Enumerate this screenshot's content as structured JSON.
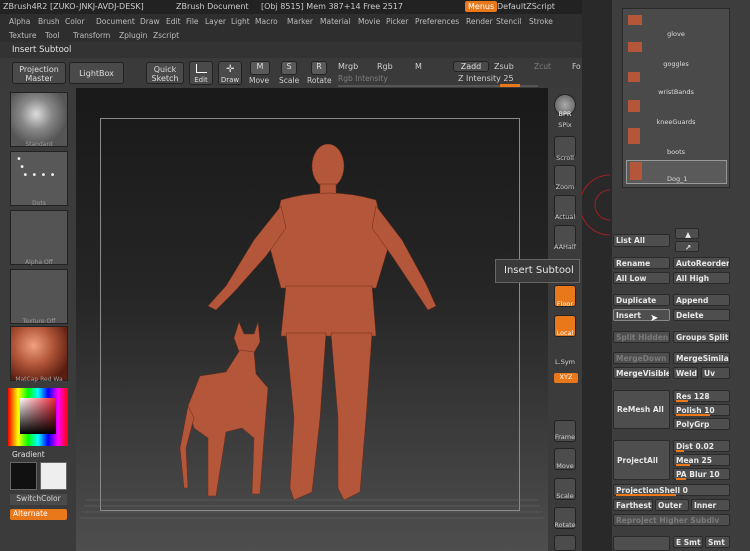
{
  "titlebar": {
    "app": "ZBrush4R2",
    "machine": "[ZUKO-JNKJ-AVDJ-DESK]",
    "document": "ZBrush Document",
    "stats": "[Obj 8515] Mem 387+14 Free 2517",
    "menus_btn": "Menus",
    "script": "DefaultZScript"
  },
  "menu": {
    "row1": [
      "Alpha",
      "Brush",
      "Color",
      "Document",
      "Draw",
      "Edit",
      "File",
      "Layer",
      "Light",
      "Macro",
      "Marker",
      "Material",
      "Movie",
      "Picker",
      "Preferences",
      "Render",
      "Stencil",
      "Stroke"
    ],
    "row2": [
      "Texture",
      "Tool",
      "Transform",
      "Zplugin",
      "Zscript"
    ]
  },
  "insert_subtool_title": "Insert Subtool",
  "toolbar": {
    "projection_master": "Projection Master",
    "lightbox": "LightBox",
    "quick_sketch": "Quick Sketch",
    "edit": "Edit",
    "draw": "Draw",
    "move": "Move",
    "scale": "Scale",
    "rotate": "Rotate",
    "mrgb": "Mrgb",
    "rgb": "Rgb",
    "m": "M",
    "rgb_intensity": "Rgb Intensity",
    "zadd": "Zadd",
    "zsub": "Zsub",
    "zcut": "Zcut",
    "z_intensity": "Z Intensity 25",
    "fo": "Fo"
  },
  "leftpanel": {
    "standard": "Standard",
    "dots": "Dots",
    "alpha_off": "Alpha Off",
    "texture_off": "Texture Off",
    "matcap": "MatCap Red Wa",
    "gradient": "Gradient",
    "switchcolor": "SwitchColor",
    "alternate": "Alternate"
  },
  "shelf": {
    "bpr": "BPR",
    "spix": "SPix",
    "scroll": "Scroll",
    "zoom": "Zoom",
    "actual": "Actual",
    "aahalf": "AAHalf",
    "floor": "Floor",
    "local": "Local",
    "lsym": "L.Sym",
    "xyz": "XYZ",
    "frame": "Frame",
    "move": "Move",
    "scale": "Scale",
    "rotate": "Rotate"
  },
  "tooltip": "Insert Subtool",
  "subtools": [
    "glove",
    "goggles",
    "wristBands",
    "kneeGuards",
    "boots",
    "Dog_1"
  ],
  "panel": {
    "list_all": "List All",
    "rename": "Rename",
    "autoreorder": "AutoReorder",
    "all_low": "All Low",
    "all_high": "All High",
    "duplicate": "Duplicate",
    "append": "Append",
    "insert": "Insert",
    "delete": "Delete",
    "split_hidden": "Split Hidden",
    "groups_split": "Groups Split",
    "mergedown": "MergeDown",
    "mergesimilar": "MergeSimilar",
    "mergevisible": "MergeVisible",
    "weld": "Weld",
    "uv": "Uv",
    "remesh_all": "ReMesh All",
    "res": "Res 128",
    "polish": "Polish 10",
    "polygrp": "PolyGrp",
    "projectall": "ProjectAll",
    "dist": "Dist 0.02",
    "mean": "Mean 25",
    "pa_blur": "PA Blur 10",
    "projectionshell": "ProjectionShell 0",
    "farthest": "Farthest",
    "outer": "Outer",
    "inner": "Inner",
    "reproject": "Reproject Higher Subdiv",
    "e_smt": "E Smt 5",
    "smt": "Smt"
  },
  "colors": {
    "accent": "#e9781a",
    "clay": "#b3563a"
  }
}
